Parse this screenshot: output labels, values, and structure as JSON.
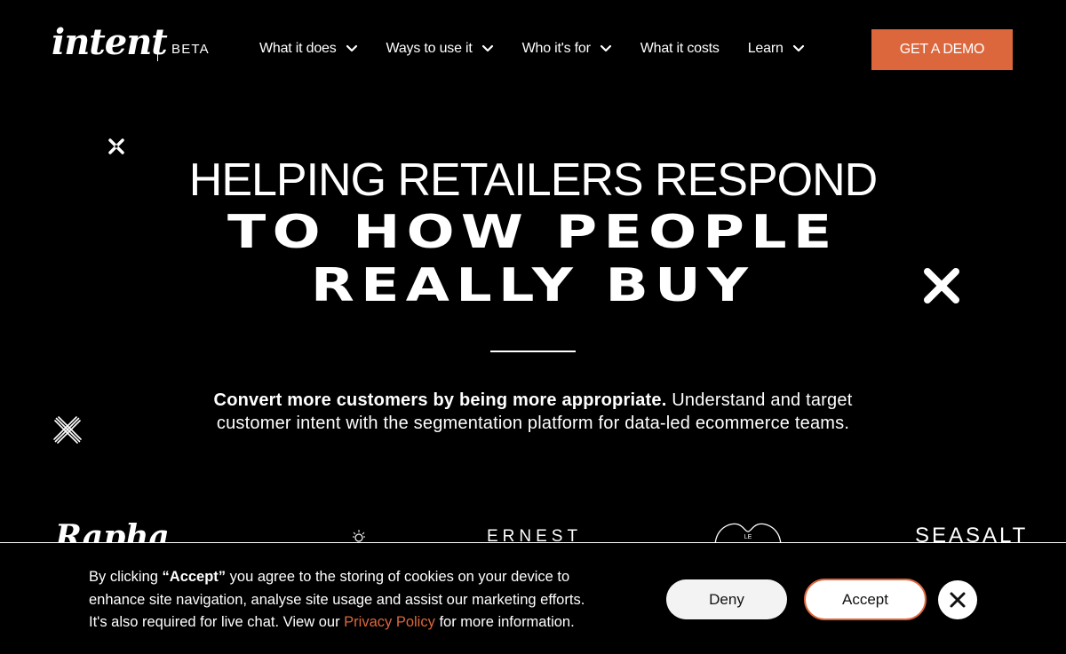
{
  "header": {
    "logo_text": "intent",
    "beta_label": "BETA",
    "nav": [
      {
        "label": "What it does",
        "has_dropdown": true,
        "icon": "chevron-down-icon"
      },
      {
        "label": "Ways to use it",
        "has_dropdown": true,
        "icon": "chevron-down-icon"
      },
      {
        "label": "Who it's for",
        "has_dropdown": true,
        "icon": "chevron-down-icon"
      },
      {
        "label": "What it costs",
        "has_dropdown": false
      },
      {
        "label": "Learn",
        "has_dropdown": true,
        "icon": "chevron-down-icon"
      }
    ],
    "cta_label": "GET A DEMO"
  },
  "hero": {
    "line1": "HELPING RETAILERS RESPOND",
    "line2": "TO HOW PEOPLE",
    "line3": "REALLY BUY",
    "subtext_bold": "Convert more customers by being more appropriate.",
    "subtext_rest": " Understand and target customer intent with the segmentation platform for data-led ecommerce teams."
  },
  "logos": {
    "items": [
      "Rapha",
      "lightbulb-logo",
      "ERNEST",
      "LE",
      "SEASALT"
    ]
  },
  "cookie_banner": {
    "text_prefix": "By clicking ",
    "text_bold": "“Accept”",
    "text_middle": " you agree to the storing of cookies on your device to enhance site navigation, analyse site usage and assist our marketing efforts. It's also required for live chat. View our ",
    "privacy_link": "Privacy Policy",
    "text_suffix": " for more information.",
    "deny_label": "Deny",
    "accept_label": "Accept",
    "close_icon": "close-icon"
  },
  "colors": {
    "accent": "#dd673c",
    "background": "#000000",
    "text": "#ffffff",
    "deny_bg": "#f3f3f3"
  }
}
